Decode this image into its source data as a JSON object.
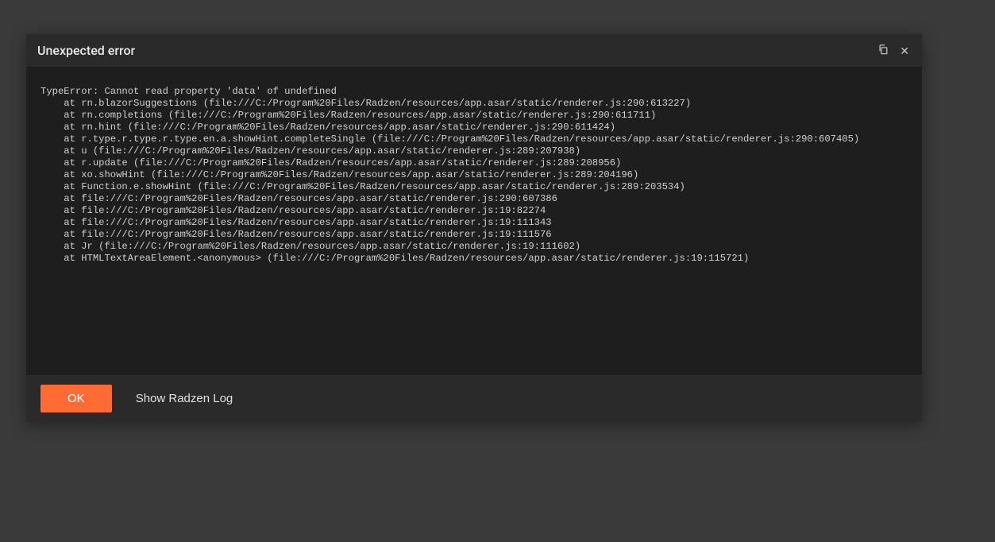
{
  "dialog": {
    "title": "Unexpected error",
    "error_message": "TypeError: Cannot read property 'data' of undefined\n    at rn.blazorSuggestions (file:///C:/Program%20Files/Radzen/resources/app.asar/static/renderer.js:290:613227)\n    at rn.completions (file:///C:/Program%20Files/Radzen/resources/app.asar/static/renderer.js:290:611711)\n    at rn.hint (file:///C:/Program%20Files/Radzen/resources/app.asar/static/renderer.js:290:611424)\n    at r.type.r.type.r.type.en.a.showHint.completeSingle (file:///C:/Program%20Files/Radzen/resources/app.asar/static/renderer.js:290:607405)\n    at u (file:///C:/Program%20Files/Radzen/resources/app.asar/static/renderer.js:289:207938)\n    at r.update (file:///C:/Program%20Files/Radzen/resources/app.asar/static/renderer.js:289:208956)\n    at xo.showHint (file:///C:/Program%20Files/Radzen/resources/app.asar/static/renderer.js:289:204196)\n    at Function.e.showHint (file:///C:/Program%20Files/Radzen/resources/app.asar/static/renderer.js:289:203534)\n    at file:///C:/Program%20Files/Radzen/resources/app.asar/static/renderer.js:290:607386\n    at file:///C:/Program%20Files/Radzen/resources/app.asar/static/renderer.js:19:82274\n    at file:///C:/Program%20Files/Radzen/resources/app.asar/static/renderer.js:19:111343\n    at file:///C:/Program%20Files/Radzen/resources/app.asar/static/renderer.js:19:111576\n    at Jr (file:///C:/Program%20Files/Radzen/resources/app.asar/static/renderer.js:19:111602)\n    at HTMLTextAreaElement.<anonymous> (file:///C:/Program%20Files/Radzen/resources/app.asar/static/renderer.js:19:115721)",
    "footer": {
      "ok_label": "OK",
      "log_label": "Show Radzen Log"
    }
  }
}
